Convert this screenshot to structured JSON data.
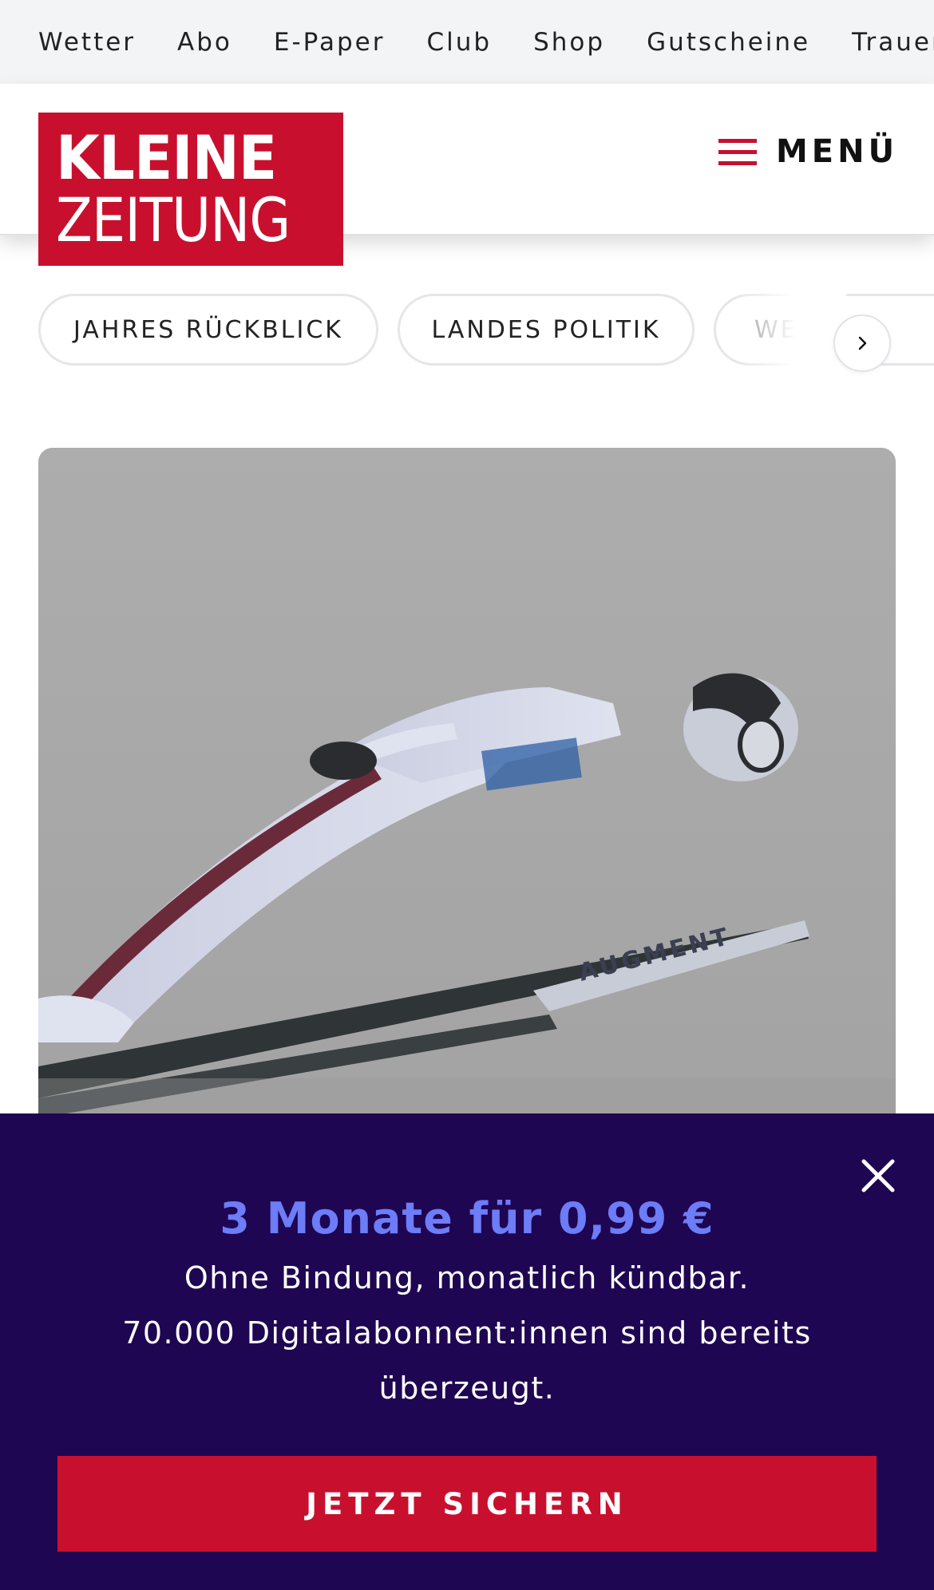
{
  "topnav": {
    "items": [
      "Wetter",
      "Abo",
      "E-Paper",
      "Club",
      "Shop",
      "Gutscheine",
      "Trauerpo"
    ]
  },
  "header": {
    "logo_line1": "KLEINE",
    "logo_line2": "ZEITUNG",
    "menu_label": "MENÜ"
  },
  "topics": {
    "items": [
      "JAHRES RÜCKBLICK",
      "LANDES POLITIK",
      "WE"
    ]
  },
  "promo": {
    "headline": "3 Monate für 0,99 €",
    "line1": "Ohne Bindung, monatlich kündbar.",
    "line2": "70.000 Digitalabonnent:innen sind bereits überzeugt.",
    "cta_label": "JETZT SICHERN"
  },
  "colors": {
    "brand_red": "#c8102e",
    "promo_bg": "#1f0652",
    "promo_accent": "#6d7cf7"
  }
}
